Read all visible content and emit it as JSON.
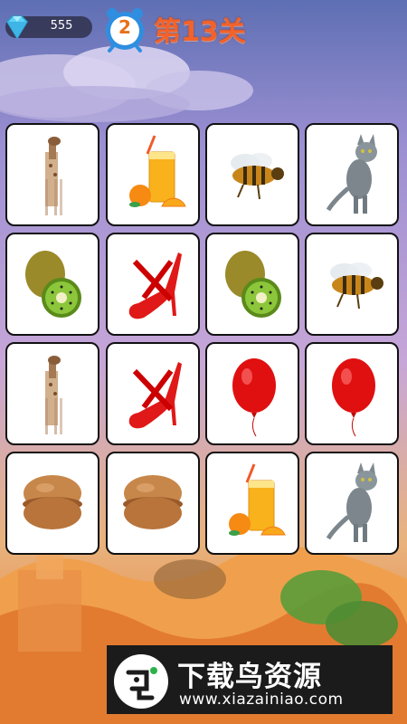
{
  "hud": {
    "gem_count": "555",
    "moves_left": "2",
    "level_title": "第13关"
  },
  "board": {
    "rows": 4,
    "cols": 4,
    "cards": [
      {
        "item": "giraffe"
      },
      {
        "item": "orange-juice"
      },
      {
        "item": "bee"
      },
      {
        "item": "cat"
      },
      {
        "item": "kiwi"
      },
      {
        "item": "red-heel"
      },
      {
        "item": "kiwi"
      },
      {
        "item": "bee"
      },
      {
        "item": "giraffe"
      },
      {
        "item": "red-heel"
      },
      {
        "item": "balloon"
      },
      {
        "item": "balloon"
      },
      {
        "item": "macaron"
      },
      {
        "item": "macaron"
      },
      {
        "item": "orange-juice"
      },
      {
        "item": "cat"
      }
    ]
  },
  "watermark": {
    "title": "下载鸟资源",
    "url": "www.xiazainiao.com"
  },
  "colors": {
    "sky_top": "#6d7ab8",
    "sky_mid": "#b9a0d6",
    "ground": "#e98a3a",
    "title": "#f2622a",
    "card_border": "#111111"
  }
}
